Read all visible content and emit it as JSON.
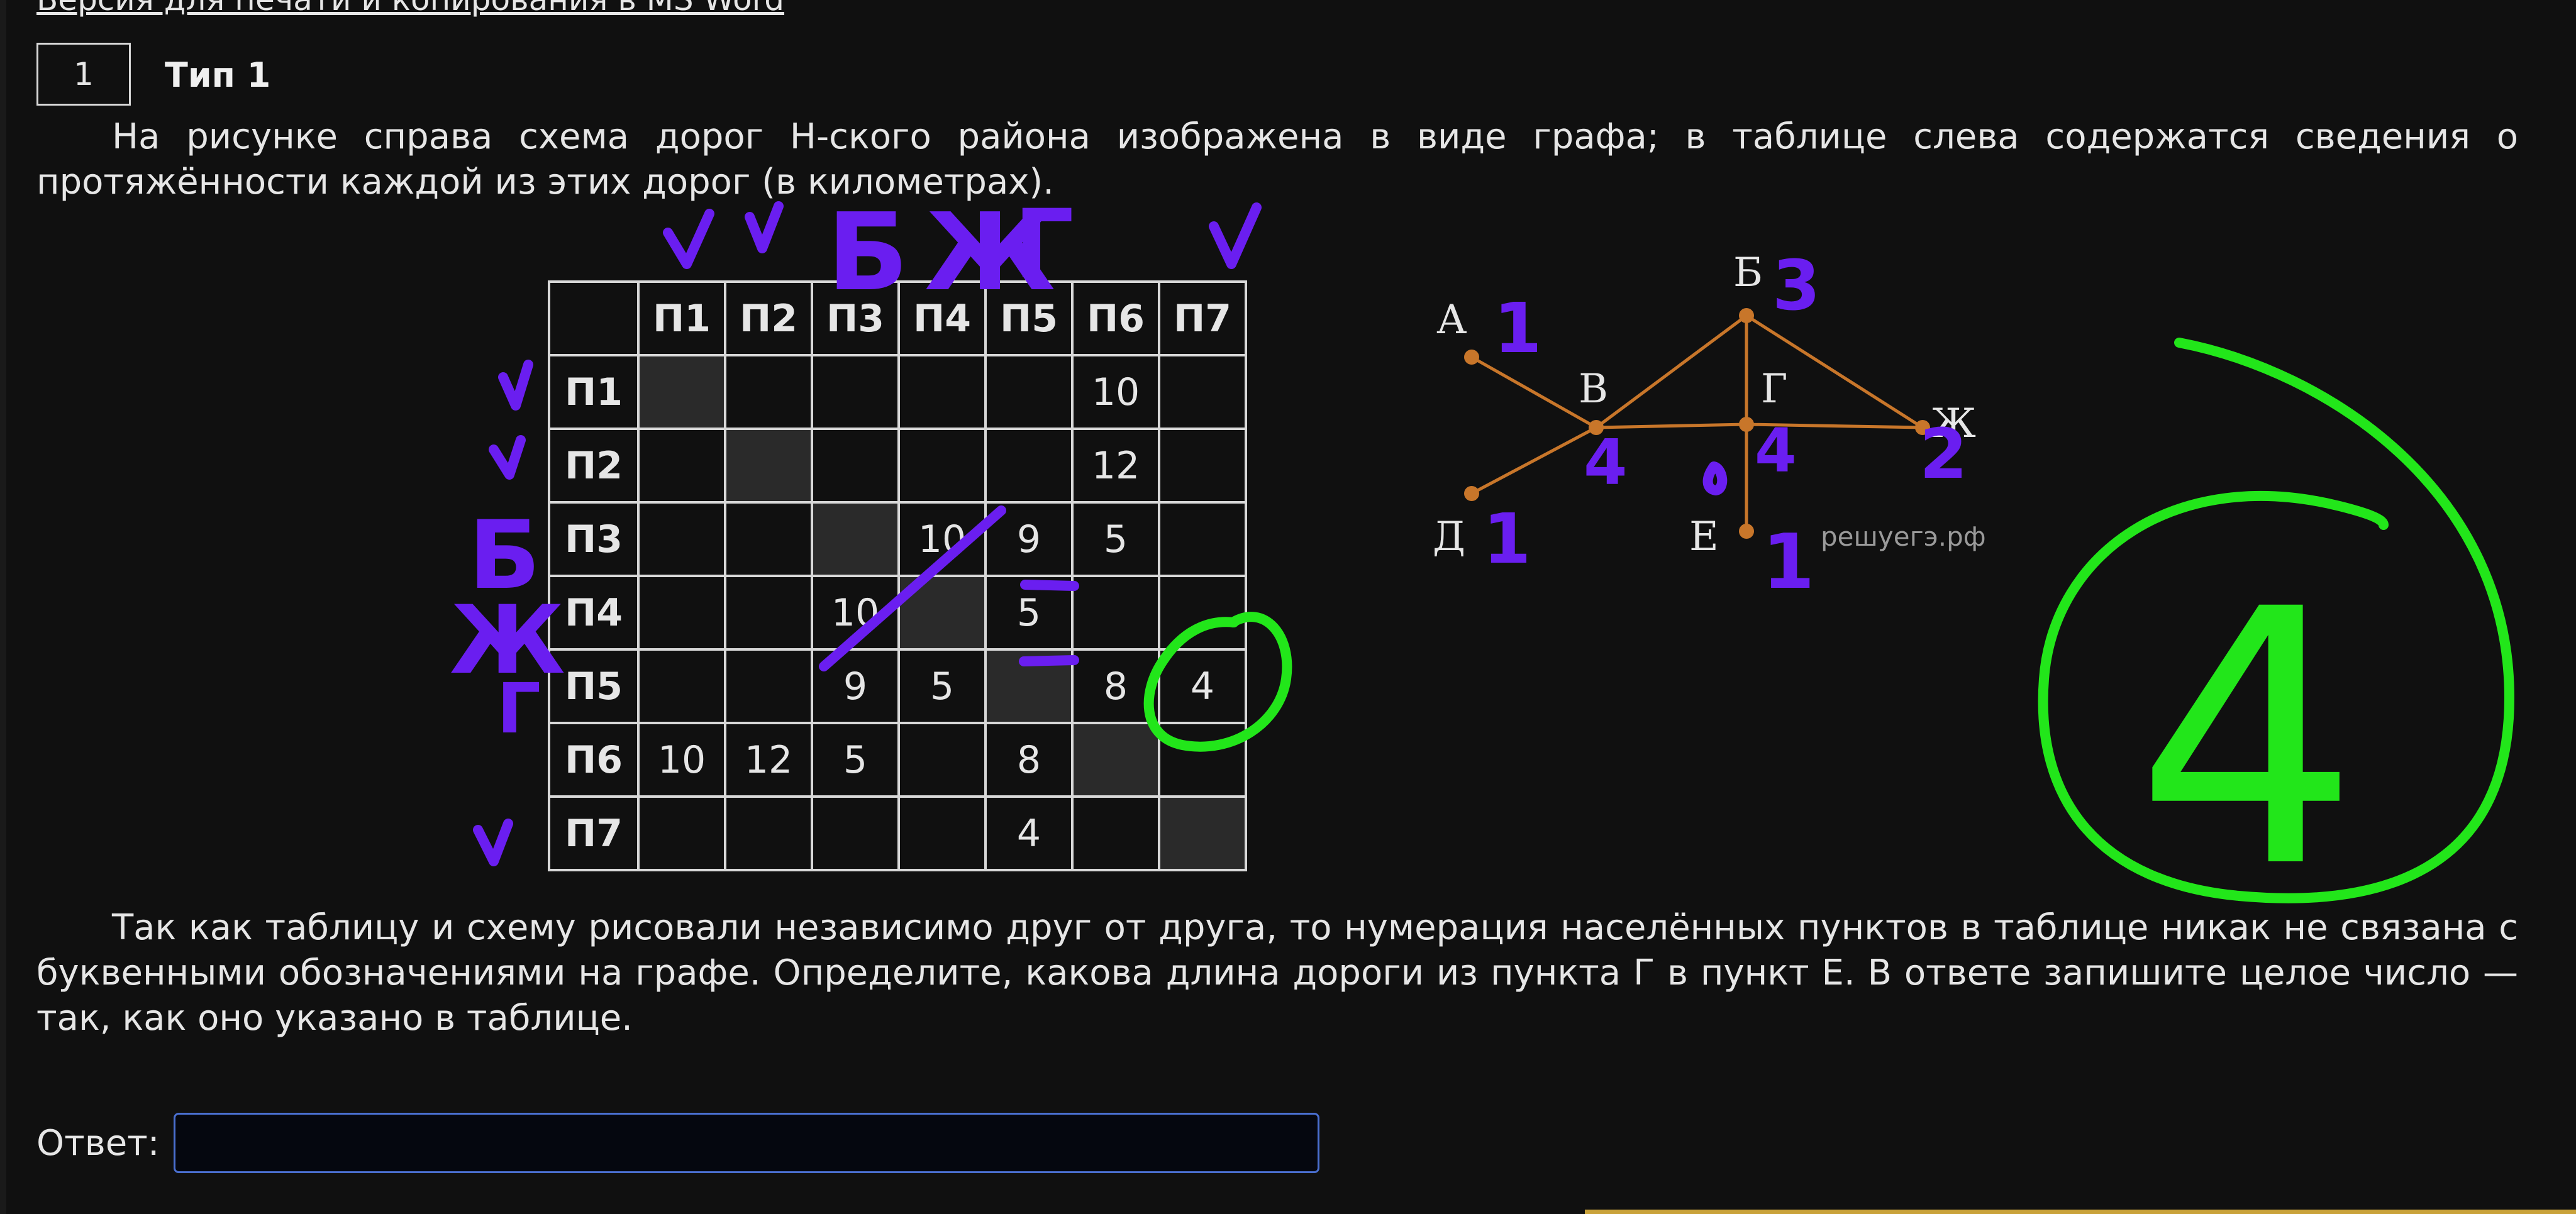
{
  "top_link": "Версия для печати и копирования в MS Word",
  "question": {
    "number": "1",
    "type": "Тип 1",
    "text_intro": "На рисунке справа схема дорог Н-ского района изображена в виде графа; в таблице слева содержатся сведения о протяжённости каждой из этих дорог (в километрах).",
    "text_task": "Так как таблицу и схему рисовали независимо друг от друга, то нумерация населённых пунктов в таблице никак не связана с буквенными обозначениями на графе. Определите, какова длина дороги из пункта Г в пункт Е. В ответе запишите целое число — так, как оно указано в таблице."
  },
  "table": {
    "headers": [
      "",
      "П1",
      "П2",
      "П3",
      "П4",
      "П5",
      "П6",
      "П7"
    ],
    "rows": [
      [
        "П1",
        "",
        "",
        "",
        "",
        "",
        "10",
        ""
      ],
      [
        "П2",
        "",
        "",
        "",
        "",
        "",
        "12",
        ""
      ],
      [
        "П3",
        "",
        "",
        "",
        "10",
        "9",
        "5",
        ""
      ],
      [
        "П4",
        "",
        "",
        "10",
        "",
        "5",
        "",
        ""
      ],
      [
        "П5",
        "",
        "",
        "9",
        "5",
        "",
        "8",
        "4"
      ],
      [
        "П6",
        "10",
        "12",
        "5",
        "",
        "8",
        "",
        ""
      ],
      [
        "П7",
        "",
        "",
        "",
        "",
        "4",
        "",
        ""
      ]
    ]
  },
  "graph": {
    "labels": {
      "A": "А",
      "B": "Б",
      "V": "В",
      "G": "Г",
      "D": "Д",
      "E": "Е",
      "Zh": "Ж"
    },
    "watermark": "решуегэ.рф",
    "edge_color": "#c8762a"
  },
  "annotations": {
    "col_marks": [
      "Б",
      "Ж",
      "Г"
    ],
    "row_marks": [
      "Б",
      "Ж",
      "Г"
    ],
    "degrees": {
      "A": "1",
      "B": "3",
      "V": "4",
      "G": "4",
      "D": "1",
      "E": "1",
      "Zh": "2"
    },
    "answer_big": "4",
    "pen_purple": "#6a1ef0",
    "pen_green": "#22e61a"
  },
  "answer": {
    "label": "Ответ:",
    "value": ""
  }
}
